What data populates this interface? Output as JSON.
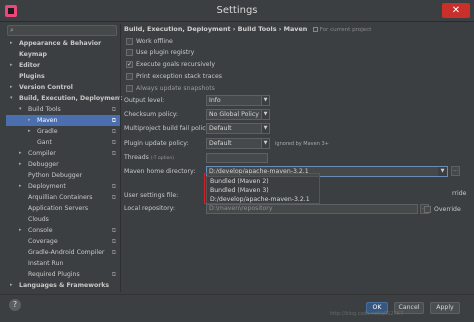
{
  "window": {
    "title": "Settings",
    "close_label": "✕"
  },
  "search": {
    "value": ""
  },
  "tree": [
    {
      "label": "Appearance & Behavior",
      "bold": true,
      "arrow": "▸",
      "indent": 0
    },
    {
      "label": "Keymap",
      "bold": true,
      "arrow": "",
      "indent": 0
    },
    {
      "label": "Editor",
      "bold": true,
      "arrow": "▸",
      "indent": 0
    },
    {
      "label": "Plugins",
      "bold": true,
      "arrow": "",
      "indent": 0
    },
    {
      "label": "Version Control",
      "bold": true,
      "arrow": "▸",
      "indent": 0
    },
    {
      "label": "Build, Execution, Deployment",
      "bold": true,
      "arrow": "▾",
      "indent": 0
    },
    {
      "label": "Build Tools",
      "bold": false,
      "arrow": "▾",
      "indent": 1,
      "copy": true
    },
    {
      "label": "Maven",
      "bold": false,
      "arrow": "▸",
      "indent": 2,
      "copy": true,
      "selected": true
    },
    {
      "label": "Gradle",
      "bold": false,
      "arrow": "▸",
      "indent": 2,
      "copy": true
    },
    {
      "label": "Gant",
      "bold": false,
      "arrow": "",
      "indent": 2,
      "copy": true
    },
    {
      "label": "Compiler",
      "bold": false,
      "arrow": "▸",
      "indent": 1,
      "copy": true
    },
    {
      "label": "Debugger",
      "bold": false,
      "arrow": "▸",
      "indent": 1
    },
    {
      "label": "Python Debugger",
      "bold": false,
      "arrow": "",
      "indent": 1
    },
    {
      "label": "Deployment",
      "bold": false,
      "arrow": "▸",
      "indent": 1,
      "copy": true
    },
    {
      "label": "Arquillian Containers",
      "bold": false,
      "arrow": "",
      "indent": 1,
      "copy": true
    },
    {
      "label": "Application Servers",
      "bold": false,
      "arrow": "",
      "indent": 1
    },
    {
      "label": "Clouds",
      "bold": false,
      "arrow": "",
      "indent": 1
    },
    {
      "label": "Console",
      "bold": false,
      "arrow": "▸",
      "indent": 1,
      "copy": true
    },
    {
      "label": "Coverage",
      "bold": false,
      "arrow": "",
      "indent": 1,
      "copy": true
    },
    {
      "label": "Gradle-Android Compiler",
      "bold": false,
      "arrow": "",
      "indent": 1,
      "copy": true
    },
    {
      "label": "Instant Run",
      "bold": false,
      "arrow": "",
      "indent": 1
    },
    {
      "label": "Required Plugins",
      "bold": false,
      "arrow": "",
      "indent": 1,
      "copy": true
    },
    {
      "label": "Languages & Frameworks",
      "bold": true,
      "arrow": "▸",
      "indent": 0
    }
  ],
  "breadcrumb": {
    "path": "Build, Execution, Deployment › Build Tools › Maven",
    "note": "For current project"
  },
  "checkboxes": [
    {
      "label": "Work offline",
      "checked": false,
      "dim": false
    },
    {
      "label": "Use plugin registry",
      "checked": false,
      "dim": false
    },
    {
      "label": "Execute goals recursively",
      "checked": true,
      "dim": false
    },
    {
      "label": "Print exception stack traces",
      "checked": false,
      "dim": false
    },
    {
      "label": "Always update snapshots",
      "checked": false,
      "dim": true
    }
  ],
  "form": {
    "output_level": {
      "label": "Output level:",
      "value": "Info"
    },
    "checksum_policy": {
      "label": "Checksum policy:",
      "value": "No Global Policy"
    },
    "multiproject": {
      "label": "Multiproject build fail policy:",
      "value": "Default"
    },
    "plugin_update": {
      "label": "Plugin update policy:",
      "value": "Default",
      "hint": "ignored by Maven 3+"
    },
    "threads": {
      "label": "Threads",
      "sub": "(-T option)",
      "value": ""
    },
    "maven_home": {
      "label": "Maven home directory:",
      "value": "D:/develop/apache-maven-3.2.1"
    },
    "user_settings": {
      "label": "User settings file:",
      "value": ""
    },
    "local_repo": {
      "label": "Local repository:",
      "value": "D:\\maven\\repository"
    },
    "override_label": "Override",
    "override_cut": "rride"
  },
  "dropdown_options": [
    "Bundled (Maven 2)",
    "Bundled (Maven 3)",
    "D:/develop/apache-maven-3.2.1"
  ],
  "footer": {
    "help": "?",
    "ok": "OK",
    "cancel": "Cancel",
    "apply": "Apply",
    "watermark": "http://blog.csdn.net/u012767"
  }
}
